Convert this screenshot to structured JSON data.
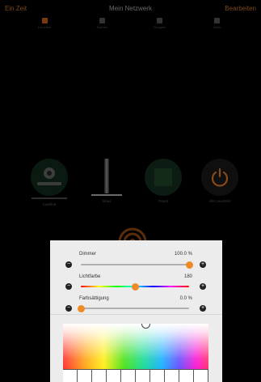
{
  "header": {
    "left": "Ein Zeit",
    "title": "Mein Netzwerk",
    "right": "Bearbeiten"
  },
  "tabs": [
    {
      "label": "Leuchten",
      "icon": "lamp-icon",
      "active": true
    },
    {
      "label": "Szenen",
      "icon": "scene-icon",
      "active": false
    },
    {
      "label": "Gruppen",
      "icon": "group-icon",
      "active": false
    },
    {
      "label": "Mehr",
      "icon": "more-icon",
      "active": false
    }
  ],
  "devices": [
    {
      "label": "Camline",
      "icon": "camera-lamp-icon"
    },
    {
      "label": "Sirius",
      "icon": "floor-lamp-icon"
    },
    {
      "label": "Panel",
      "icon": "panel-icon"
    },
    {
      "label": "Alle Leuchten",
      "icon": "power-icon"
    }
  ],
  "sliders": {
    "dimmer": {
      "label": "Dimmer",
      "value": "100.0 %",
      "level": 1.0
    },
    "lichtfarbe": {
      "label": "Lichtfarbe",
      "value": "180",
      "level": 0.5
    },
    "farbsaettigung": {
      "label": "Farbsättigung",
      "value": "0.0 %",
      "level": 0.0
    }
  },
  "colors": {
    "accent": "#f08a24",
    "sheet_bg": "#ececec",
    "background": "#000000"
  }
}
